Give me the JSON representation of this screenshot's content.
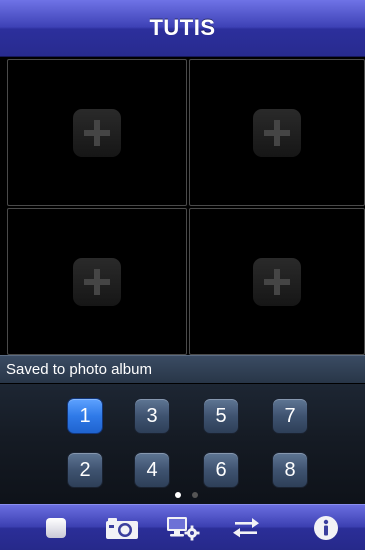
{
  "header": {
    "title": "TUTIS"
  },
  "camera_slots": [
    {
      "id": "slot-1",
      "action": "add"
    },
    {
      "id": "slot-2",
      "action": "add"
    },
    {
      "id": "slot-3",
      "action": "add"
    },
    {
      "id": "slot-4",
      "action": "add"
    }
  ],
  "status": {
    "message": "Saved to photo album"
  },
  "channels": {
    "selected": "1",
    "items": [
      "1",
      "3",
      "5",
      "7",
      "2",
      "4",
      "6",
      "8"
    ]
  },
  "pager": {
    "pages": 2,
    "current": 1
  },
  "toolbar": {
    "icons": [
      "stop-icon",
      "camera-snapshot-icon",
      "device-settings-icon",
      "switch-arrows-icon",
      "info-icon"
    ]
  },
  "colors": {
    "bar_blue": "#3e42b6",
    "active_channel": "#2f7ae8",
    "channel_button": "#3f5370",
    "status_bar": "#2f3e54"
  }
}
